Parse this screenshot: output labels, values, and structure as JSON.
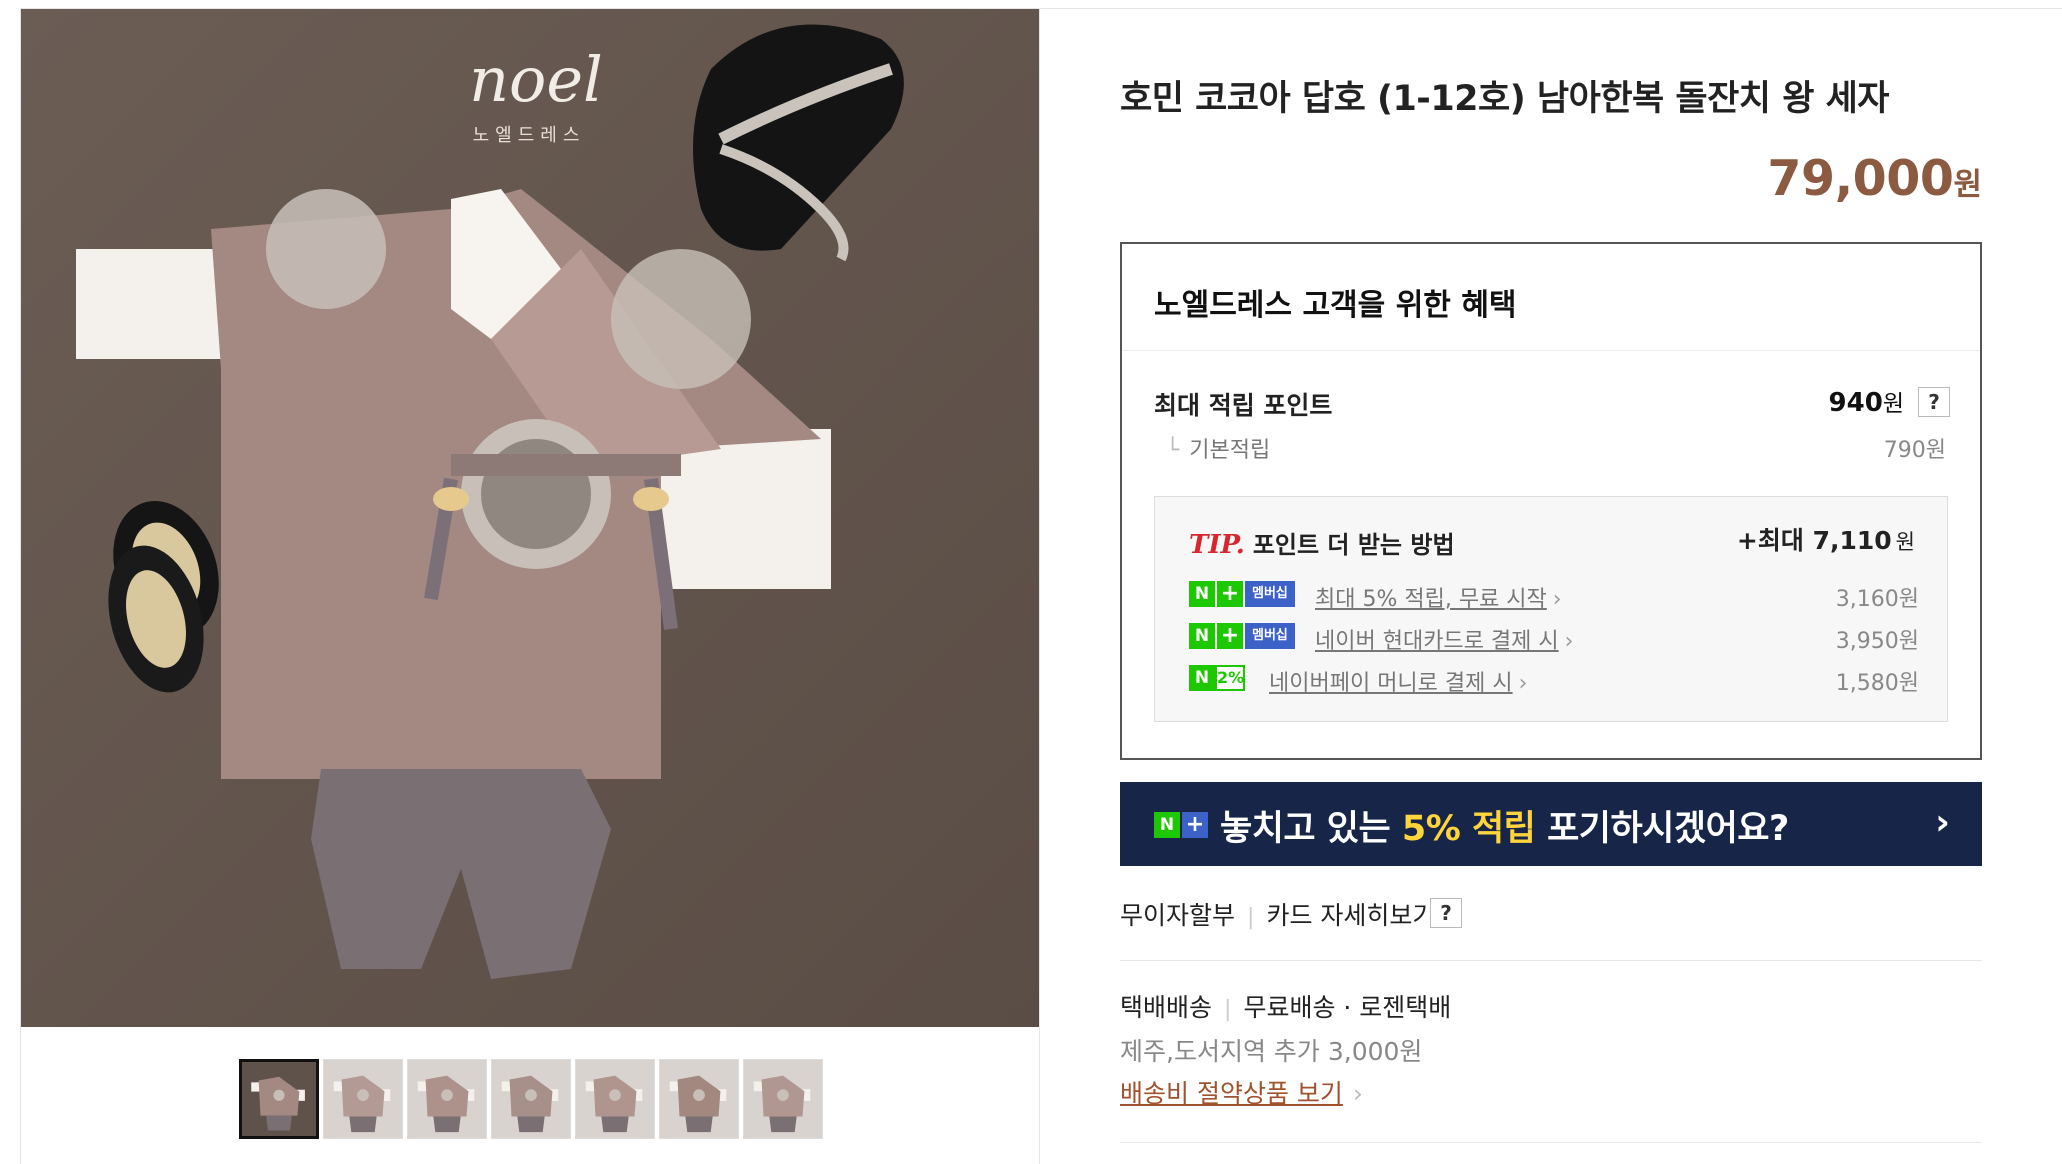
{
  "product": {
    "title": "호민 코코아 답호 (1-12호) 남아한복 돌잔치 왕 세자",
    "price": "79,000",
    "price_unit": "원"
  },
  "image": {
    "brand_logo": "noel",
    "brand_subtitle": "노엘드레스"
  },
  "thumbnails": [
    "thumb-1",
    "thumb-2",
    "thumb-3",
    "thumb-4",
    "thumb-5",
    "thumb-6",
    "thumb-7"
  ],
  "benefit": {
    "title": "노엘드레스 고객을 위한 혜택",
    "max_points_label": "최대 적립 포인트",
    "max_points_value": "940",
    "max_points_unit": "원",
    "help": "?",
    "basic_mark": "└",
    "basic_label": "기본적립",
    "basic_value": "790원",
    "tip": {
      "tip_label": "TIP.",
      "title": "포인트 더 받는 방법",
      "max_prefix": "+최대",
      "max_value": "7,110",
      "max_unit": "원",
      "rows": [
        {
          "badge_n": "N",
          "badge_plus": "+",
          "badge_text": "멤버십",
          "text": "최대 5% 적립, 무료 시작",
          "chev": "›",
          "amount": "3,160원"
        },
        {
          "badge_n": "N",
          "badge_plus": "+",
          "badge_text": "멤버십",
          "text": "네이버 현대카드로 결제 시",
          "chev": "›",
          "amount": "3,950원"
        },
        {
          "badge_n": "N",
          "badge_text": "2%",
          "text": "네이버페이 머니로 결제 시",
          "chev": "›",
          "amount": "1,580원"
        }
      ]
    }
  },
  "npay_banner": {
    "badge_n": "N",
    "badge_plus": "+",
    "text_before": "놓치고 있는 ",
    "highlight": "5% 적립",
    "text_after": " 포기하시겠어요?",
    "arrow": "›"
  },
  "installment": {
    "label": "무이자할부",
    "divider": "|",
    "card_detail": "카드 자세히보기",
    "help": "?"
  },
  "shipping": {
    "method": "택배배송",
    "divider": "|",
    "fee": "무료배송",
    "courier": "· 로젠택배",
    "extra": "제주,도서지역 추가 3,000원",
    "link": "배송비 절약상품 보기",
    "chev": "›"
  },
  "colors": {
    "price": "#8c5a40",
    "banner_bg": "#172648",
    "banner_highlight": "#ffd43b",
    "naver_green": "#1ec800",
    "membership_blue": "#3d62c7",
    "tip_red": "#d8262e"
  }
}
